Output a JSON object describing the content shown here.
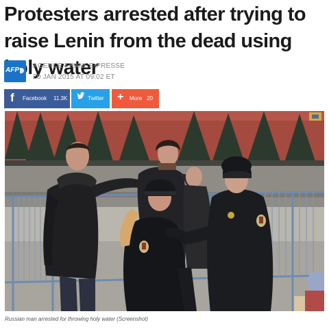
{
  "article": {
    "headline": "Protesters arrested after trying to raise Lenin from the dead using holy water",
    "agency": "AGENCE FRANCE-PRESSE",
    "date": "20 JAN 2015 AT 09:02 ET",
    "logo_text": "AFP",
    "caption": "Russian man arrested for throwing holy water (Screenshot)"
  },
  "share": {
    "facebook": {
      "icon": "facebook-icon",
      "label": "Facebook",
      "count": "11.3K",
      "color": "#3b5c9a"
    },
    "twitter": {
      "icon": "twitter-bird-icon",
      "label": "Twitter",
      "color": "#27a1e8"
    },
    "more": {
      "icon": "plus-icon",
      "label": "More",
      "count": "20",
      "color": "#f05a3c"
    }
  },
  "colors": {
    "logo": "#1a73c8",
    "headline": "#1b1b1b",
    "meta": "#888888"
  }
}
